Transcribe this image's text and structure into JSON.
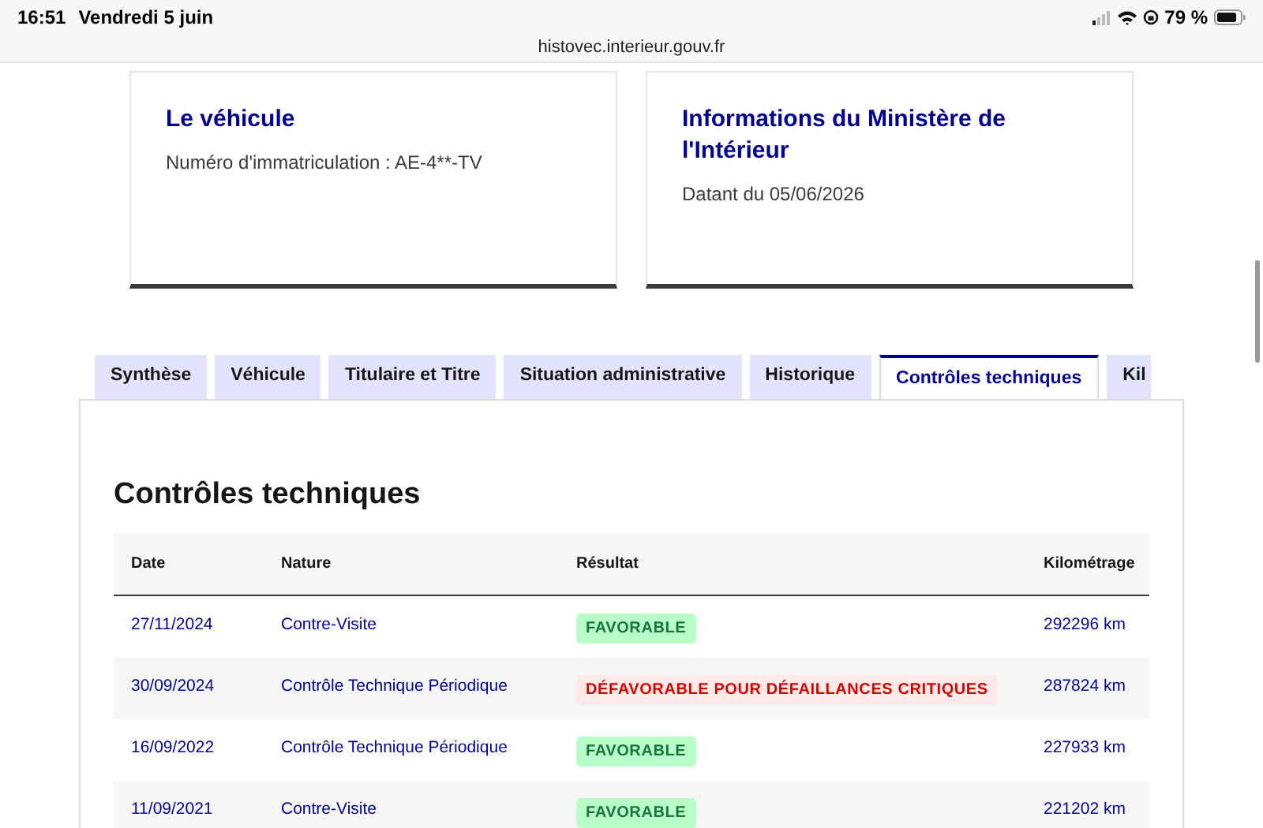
{
  "status_bar": {
    "time": "16:51",
    "date": "Vendredi 5 juin",
    "battery": "79 %"
  },
  "address_bar": {
    "url": "histovec.interieur.gouv.fr"
  },
  "cards": [
    {
      "title": "Le véhicule",
      "text": "Numéro d'immatriculation : AE-4**-TV"
    },
    {
      "title": "Informations du Ministère de l'Intérieur",
      "text": "Datant du 05/06/2026"
    }
  ],
  "tabs": [
    {
      "label": "Synthèse",
      "selected": false
    },
    {
      "label": "Véhicule",
      "selected": false
    },
    {
      "label": "Titulaire et Titre",
      "selected": false
    },
    {
      "label": "Situation administrative",
      "selected": false
    },
    {
      "label": "Historique",
      "selected": false
    },
    {
      "label": "Contrôles techniques",
      "selected": true
    },
    {
      "label": "Kil",
      "selected": false
    }
  ],
  "section_title": "Contrôles techniques",
  "table": {
    "columns": [
      "Date",
      "Nature",
      "Résultat",
      "Kilométrage"
    ],
    "rows": [
      {
        "date": "27/11/2024",
        "nature": "Contre-Visite",
        "result": {
          "text": "FAVORABLE",
          "kind": "success"
        },
        "mileage": "292296 km"
      },
      {
        "date": "30/09/2024",
        "nature": "Contrôle Technique Périodique",
        "result": {
          "text": "DÉFAVORABLE POUR DÉFAILLANCES CRITIQUES",
          "kind": "error"
        },
        "mileage": "287824 km"
      },
      {
        "date": "16/09/2022",
        "nature": "Contrôle Technique Périodique",
        "result": {
          "text": "FAVORABLE",
          "kind": "success"
        },
        "mileage": "227933 km"
      },
      {
        "date": "11/09/2021",
        "nature": "Contre-Visite",
        "result": {
          "text": "FAVORABLE",
          "kind": "success"
        },
        "mileage": "221202 km"
      }
    ]
  }
}
